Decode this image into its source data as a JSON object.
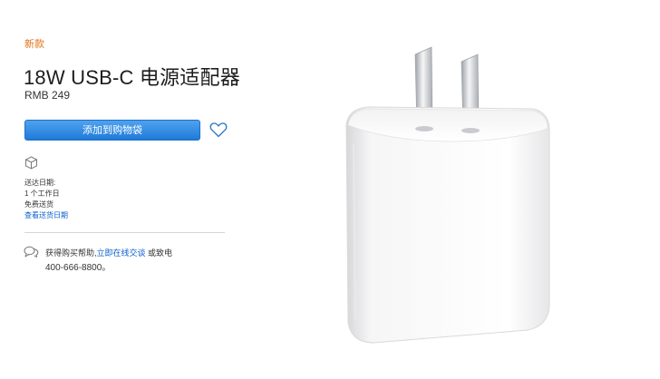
{
  "product": {
    "badge": "新款",
    "title": "18W USB-C 电源适配器",
    "price": "RMB 249",
    "add_to_bag_label": "添加到购物袋"
  },
  "shipping": {
    "label": "送达日期:",
    "days": "1 个工作日",
    "fee": "免费送货",
    "link_label": "查看送货日期"
  },
  "help": {
    "prefix": "获得购买帮助,",
    "chat_link": "立即在线交谈",
    "suffix": " 或致电",
    "phone": "400-666-8800。"
  },
  "colors": {
    "badge": "#e2741c",
    "button": "#1f7ad8",
    "link": "#0a5fcc"
  },
  "icons": {
    "wishlist": "heart-icon",
    "shipping": "box-icon",
    "help": "chat-icon"
  }
}
